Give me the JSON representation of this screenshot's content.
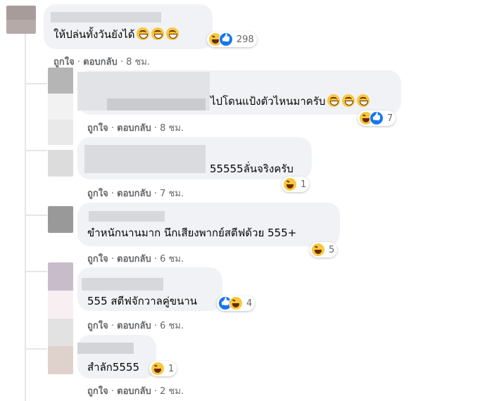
{
  "comments": [
    {
      "text": "ให้ปล่นทั้งวันยังได้",
      "emoji": [
        "grin-emoji",
        "grin-emoji",
        "grin-emoji"
      ],
      "reaction_count": "298",
      "reactions": [
        "haha",
        "like"
      ],
      "time": "8 ชม."
    },
    {
      "text": "ไปโดนแป้งตัวไหนมาครับ",
      "emoji": [
        "grin-emoji",
        "grin-emoji",
        "grin-emoji"
      ],
      "reaction_count": "7",
      "reactions": [
        "haha",
        "like"
      ],
      "time": "8 ชม."
    },
    {
      "text": "55555ลั่นจริงครับ",
      "emoji": [],
      "reaction_count": "1",
      "reactions": [
        "haha"
      ],
      "time": "7 ชม."
    },
    {
      "text": "ขำหนักนานมาก นึกเสียงพากย์สตีฟด้วย 555+",
      "emoji": [],
      "reaction_count": "5",
      "reactions": [
        "haha"
      ],
      "time": "6 ชม."
    },
    {
      "text": "555 สตีฟจักวาลคู่ขนาน",
      "emoji": [],
      "reaction_count": "4",
      "reactions": [
        "like",
        "haha"
      ],
      "time": "6 ชม."
    },
    {
      "text": "สำลัก5555",
      "emoji": [],
      "reaction_count": "1",
      "reactions": [
        "haha"
      ],
      "time": "2 ชม."
    }
  ],
  "actions": {
    "like": "ถูกใจ",
    "reply": "ตอบกลับ",
    "sep": "·"
  },
  "colors": {
    "bubble": "#f0f2f5",
    "meta": "#65676b",
    "text": "#050505",
    "like": "#1877f2",
    "haha": "#f7c740"
  }
}
